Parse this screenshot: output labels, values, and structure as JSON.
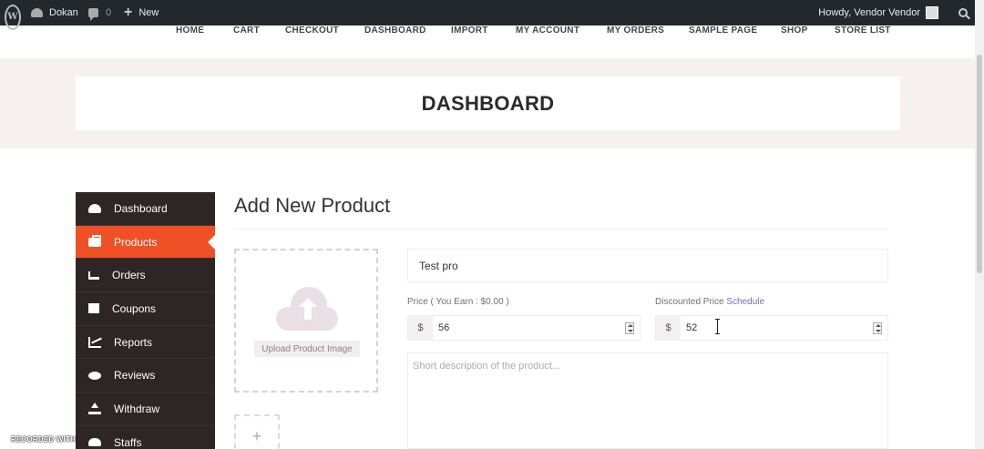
{
  "adminbar": {
    "site_name": "Dokan",
    "comments_count": "0",
    "new_label": "New",
    "howdy": "Howdy, Vendor Vendor"
  },
  "nav": {
    "items": [
      "HOME",
      "CART",
      "CHECKOUT",
      "DASHBOARD",
      "IMPORT",
      "MY ACCOUNT",
      "MY ORDERS",
      "SAMPLE PAGE",
      "SHOP",
      "STORE LIST"
    ]
  },
  "banner": {
    "title": "DASHBOARD"
  },
  "sidebar": {
    "items": [
      {
        "label": "Dashboard",
        "icon": "dashboard-icon"
      },
      {
        "label": "Products",
        "icon": "briefcase-icon",
        "active": true
      },
      {
        "label": "Orders",
        "icon": "cart-icon"
      },
      {
        "label": "Coupons",
        "icon": "gift-icon"
      },
      {
        "label": "Reports",
        "icon": "chart-icon"
      },
      {
        "label": "Reviews",
        "icon": "comments-icon"
      },
      {
        "label": "Withdraw",
        "icon": "upload-icon"
      },
      {
        "label": "Staffs",
        "icon": "users-icon"
      }
    ],
    "active_color": "#f05025",
    "bg_color": "#2e2624"
  },
  "main": {
    "title": "Add New Product",
    "upload_button": "Upload Product Image",
    "gallery_add": "+",
    "product_name": "Test pro",
    "price_label": "Price ( You Earn : $0.00 )",
    "discount_label": "Discounted Price",
    "schedule_link": "Schedule",
    "currency": "$",
    "price_value": "56",
    "discount_value": "52",
    "description_placeholder": "Short description of the product..."
  },
  "watermark": "RECORDED WITH"
}
